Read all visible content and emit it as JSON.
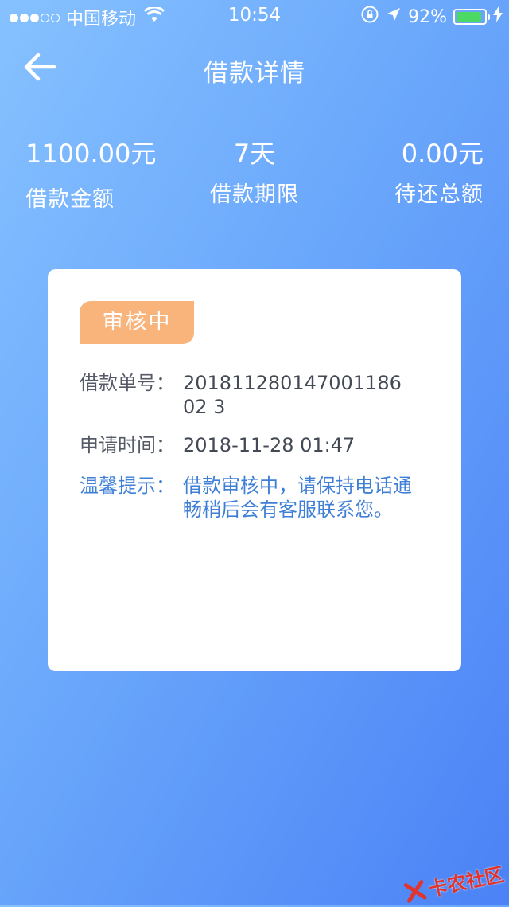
{
  "status_bar": {
    "carrier": "中国移动",
    "time": "10:54",
    "battery_text": "92%",
    "battery_level": 0.92,
    "battery_color": "#4cd964"
  },
  "nav": {
    "title": "借款详情",
    "back_icon": "arrow-left-icon"
  },
  "summary": {
    "amount_value": "1100.00元",
    "amount_label": "借款金额",
    "term_value": "7天",
    "term_label": "借款期限",
    "due_value": "0.00元",
    "due_label": "待还总额"
  },
  "card": {
    "status_badge": "审核中",
    "badge_color": "#f9b47c",
    "order_label": "借款单号：",
    "order_value": "20181128014700118602 3",
    "time_label": "申请时间：",
    "time_value": "2018-11-28 01:47",
    "tip_label": "温馨提示：",
    "tip_value": "借款审核中，请保持电话通畅稍后会有客服联系您。",
    "tip_color": "#3f7fd6"
  },
  "watermark": {
    "text": "卡农社区"
  }
}
